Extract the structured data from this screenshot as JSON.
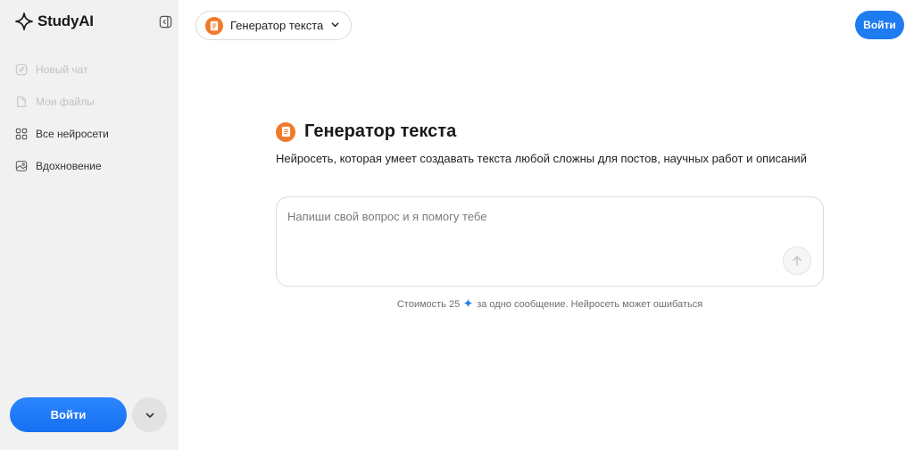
{
  "app": {
    "name": "StudyAI"
  },
  "sidebar": {
    "items": [
      {
        "label": "Новый чат",
        "icon": "new-chat-icon",
        "disabled": true
      },
      {
        "label": "Мои файлы",
        "icon": "file-icon",
        "disabled": true
      },
      {
        "label": "Все нейросети",
        "icon": "grid-icon",
        "disabled": false
      },
      {
        "label": "Вдохновение",
        "icon": "image-icon",
        "disabled": false
      }
    ],
    "login_label": "Войти"
  },
  "header": {
    "model_label": "Генератор текста",
    "login_label": "Войти"
  },
  "main": {
    "title": "Генератор текста",
    "description": "Нейросеть, которая умеет создавать текста любой сложны для постов, научных работ и описаний",
    "prompt_placeholder": "Напиши свой вопрос и я помогу тебе",
    "cost_prefix": "Стоимость 25",
    "cost_suffix": "за одно сообщение. Нейросеть может ошибаться"
  },
  "colors": {
    "accent": "#1f7bf0",
    "badge": "#f07a2a",
    "sidebar_bg": "#f1f1f1"
  }
}
